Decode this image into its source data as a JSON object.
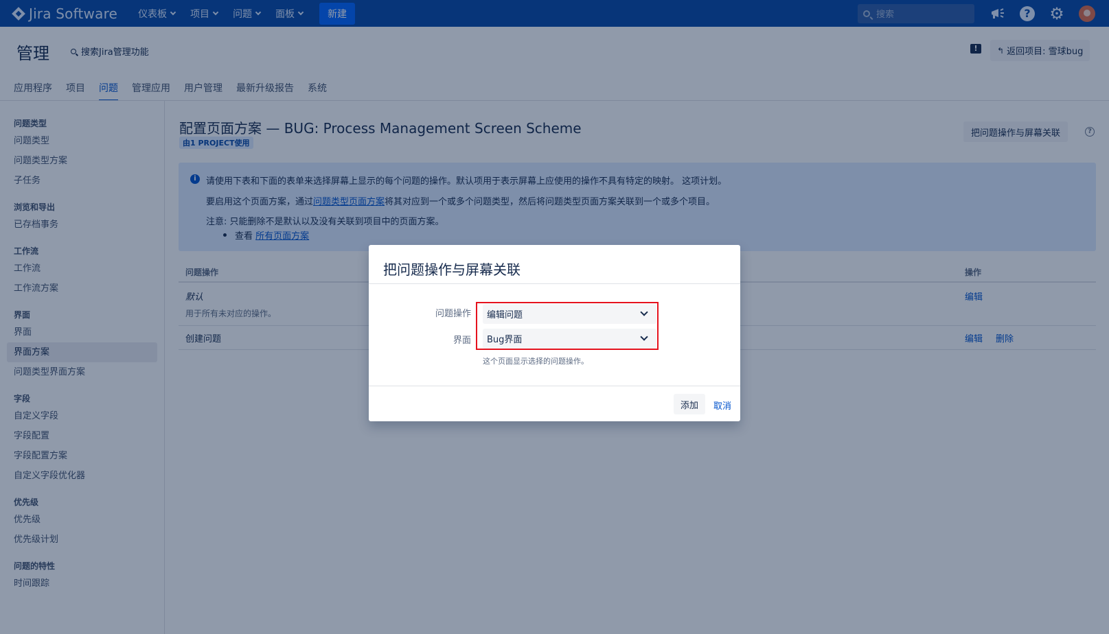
{
  "topnav": {
    "logo_text": "Jira Software",
    "menu": [
      {
        "label": "仪表板"
      },
      {
        "label": "项目"
      },
      {
        "label": "问题"
      },
      {
        "label": "面板"
      }
    ],
    "create_label": "新建",
    "search_placeholder": "搜索",
    "icons": [
      "notification-megaphone-icon",
      "help-icon",
      "settings-gear-icon",
      "user-avatar"
    ]
  },
  "admin": {
    "title": "管理",
    "search_label": "搜索Jira管理功能",
    "back_label": "返回项目: 雪球bug",
    "tabs": [
      {
        "label": "应用程序",
        "active": false
      },
      {
        "label": "项目",
        "active": false
      },
      {
        "label": "问题",
        "active": true
      },
      {
        "label": "管理应用",
        "active": false
      },
      {
        "label": "用户管理",
        "active": false
      },
      {
        "label": "最新升级报告",
        "active": false
      },
      {
        "label": "系统",
        "active": false
      }
    ]
  },
  "sidebar": {
    "sections": [
      {
        "heading": "问题类型",
        "items": [
          "问题类型",
          "问题类型方案",
          "子任务"
        ]
      },
      {
        "heading": "浏览和导出",
        "items": [
          "已存档事务"
        ]
      },
      {
        "heading": "工作流",
        "items": [
          "工作流",
          "工作流方案"
        ]
      },
      {
        "heading": "界面",
        "items": [
          "界面",
          "界面方案",
          "问题类型界面方案"
        ]
      },
      {
        "heading": "字段",
        "items": [
          "自定义字段",
          "字段配置",
          "字段配置方案",
          "自定义字段优化器"
        ]
      },
      {
        "heading": "优先级",
        "items": [
          "优先级",
          "优先级计划"
        ]
      },
      {
        "heading": "问题的特性",
        "items": [
          "时间跟踪"
        ]
      }
    ],
    "active_item": "界面方案"
  },
  "main": {
    "heading": "配置页面方案 — BUG: Process Management Screen Scheme",
    "usage_lozenge": "由1 PROJECT使用",
    "assoc_button": "把问题操作与屏幕关联",
    "info": {
      "line1": "请使用下表和下面的表单来选择屏幕上显示的每个问题的操作。默认项用于表示屏幕上应使用的操作不具有特定的映射。 这项计划。",
      "line2_pre": "要启用这个页面方案，通过",
      "line2_link": "问题类型页面方案",
      "line2_post": "将其对应到一个或多个问题类型，然后将问题类型页面方案关联到一个或多个项目。",
      "line3": "注意: 只能删除不是默认以及没有关联到项目中的页面方案。",
      "bullet_pre": "查看 ",
      "bullet_link": "所有页面方案"
    },
    "table": {
      "col_operation": "问题操作",
      "col_actions": "操作",
      "rows": [
        {
          "name": "默认",
          "desc": "用于所有未对应的操作。",
          "actions": [
            "编辑"
          ]
        },
        {
          "name": "创建问题",
          "desc": "",
          "actions": [
            "编辑",
            "删除"
          ]
        }
      ]
    }
  },
  "dialog": {
    "title": "把问题操作与屏幕关联",
    "operation_label": "问题操作",
    "operation_value": "编辑问题",
    "screen_label": "界面",
    "screen_value": "Bug界面",
    "screen_desc": "这个页面显示选择的问题操作。",
    "add_label": "添加",
    "cancel_label": "取消",
    "highlight_color": "#e5121d"
  }
}
